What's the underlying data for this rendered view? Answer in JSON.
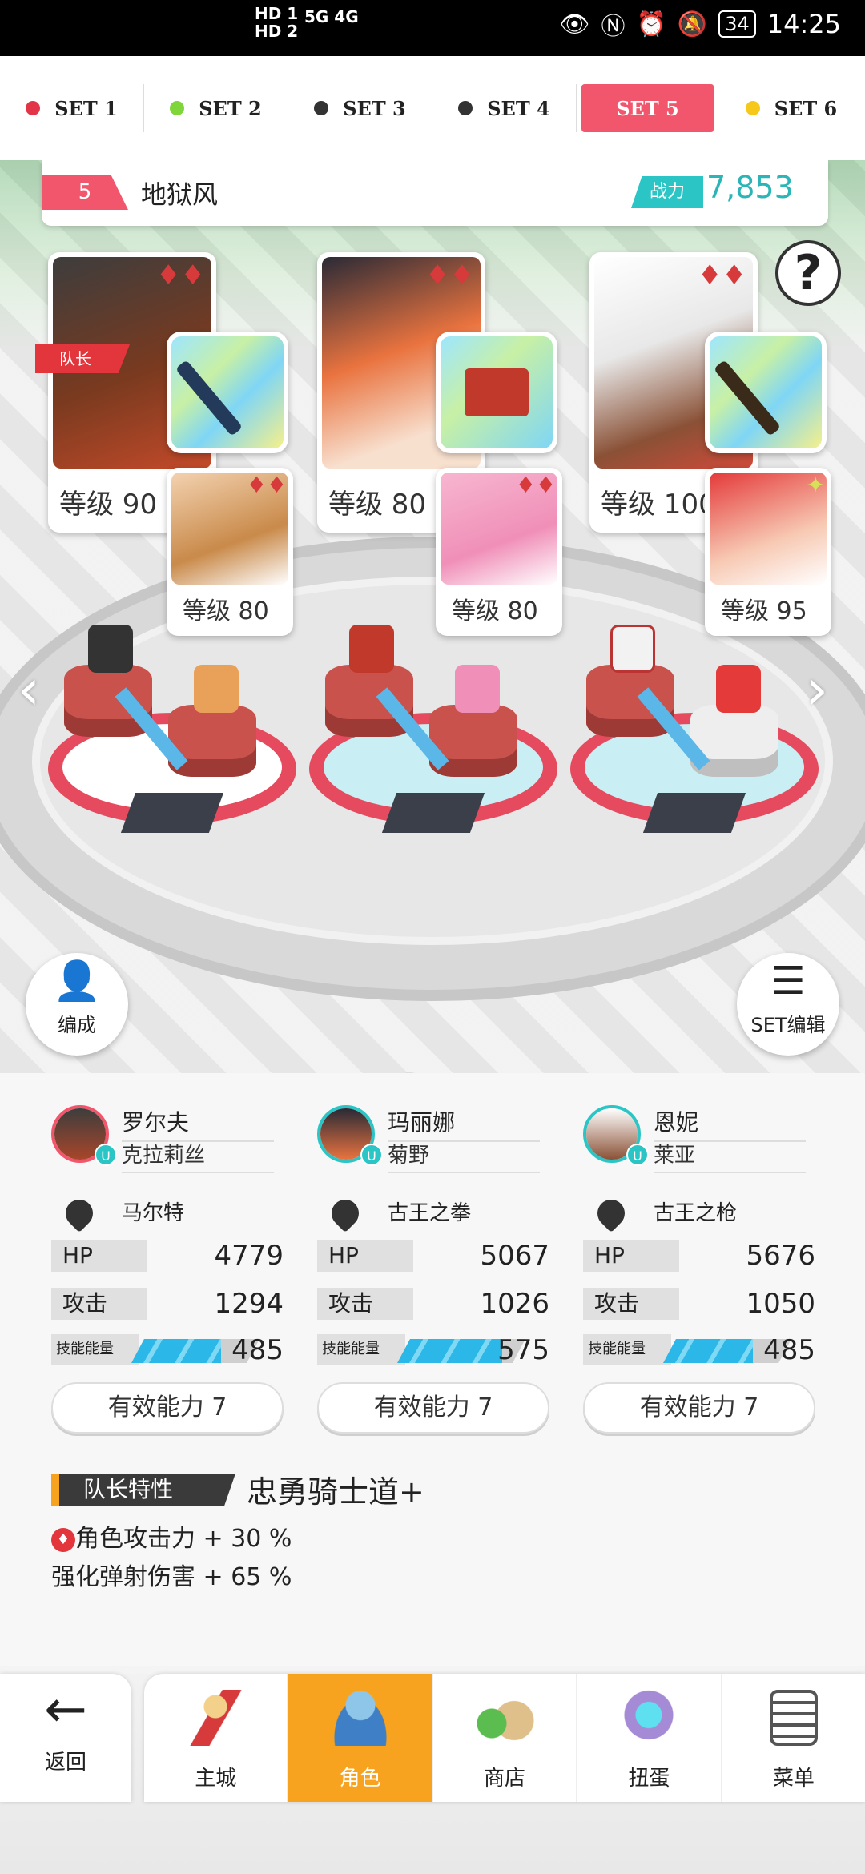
{
  "status_bar": {
    "left_badges": "HD 1\nHD 2",
    "network": "5G 4G",
    "time": "14:25",
    "battery": "34"
  },
  "set_tabs": [
    {
      "label": "SET 1",
      "dot_color": "#e23648"
    },
    {
      "label": "SET 2",
      "dot_color": "#7fd63a"
    },
    {
      "label": "SET 3",
      "dot_color": "#333333"
    },
    {
      "label": "SET 4",
      "dot_color": "#333333"
    },
    {
      "label": "SET 5",
      "dot_color": "",
      "active": true
    },
    {
      "label": "SET 6",
      "dot_color": "#f6c81c"
    }
  ],
  "team": {
    "number": "5",
    "name": "地狱风",
    "power_label": "战力",
    "power": "7,853"
  },
  "help_icon": "?",
  "leader_tag": "队长",
  "heroes": [
    {
      "level": "等级 90",
      "support_level": "等级 80",
      "suit": "♦♦",
      "support_suit": "♦♦"
    },
    {
      "level": "等级 80",
      "support_level": "等级 80",
      "suit": "♦♦",
      "support_suit": "♦♦"
    },
    {
      "level": "等级 100",
      "support_level": "等级 95",
      "suit": "♦♦",
      "support_suit": "✦"
    }
  ],
  "arrows": {
    "left": "‹",
    "right": "›"
  },
  "page_dots": {
    "count": 10,
    "active_index": 4
  },
  "formation_button": {
    "label": "编成"
  },
  "set_edit_button": {
    "label": "SET编辑"
  },
  "members": [
    {
      "main": "罗尔夫",
      "sub": "克拉莉丝",
      "weapon": "马尔特",
      "hp_label": "HP",
      "hp": "4779",
      "atk_label": "攻击",
      "atk": "1294",
      "energy_label": "技能能量",
      "energy": "485",
      "energy_fill": 0.7,
      "ability": "有效能力 7"
    },
    {
      "main": "玛丽娜",
      "sub": "菊野",
      "weapon": "古王之拳",
      "hp_label": "HP",
      "hp": "5067",
      "atk_label": "攻击",
      "atk": "1026",
      "energy_label": "技能能量",
      "energy": "575",
      "energy_fill": 0.82,
      "ability": "有效能力 7"
    },
    {
      "main": "恩妮",
      "sub": "莱亚",
      "weapon": "古王之枪",
      "hp_label": "HP",
      "hp": "5676",
      "atk_label": "攻击",
      "atk": "1050",
      "energy_label": "技能能量",
      "energy": "485",
      "energy_fill": 0.7,
      "ability": "有效能力 7"
    }
  ],
  "leader_trait": {
    "label": "队长特性",
    "title": "忠勇骑士道+",
    "line1": "角色攻击力 + 30 %",
    "line1_icon": "♦",
    "line2": "强化弹射伤害 + 65 %"
  },
  "nav": {
    "back": "返回",
    "tabs": [
      "主城",
      "角色",
      "商店",
      "扭蛋",
      "菜单"
    ],
    "active": "角色"
  }
}
